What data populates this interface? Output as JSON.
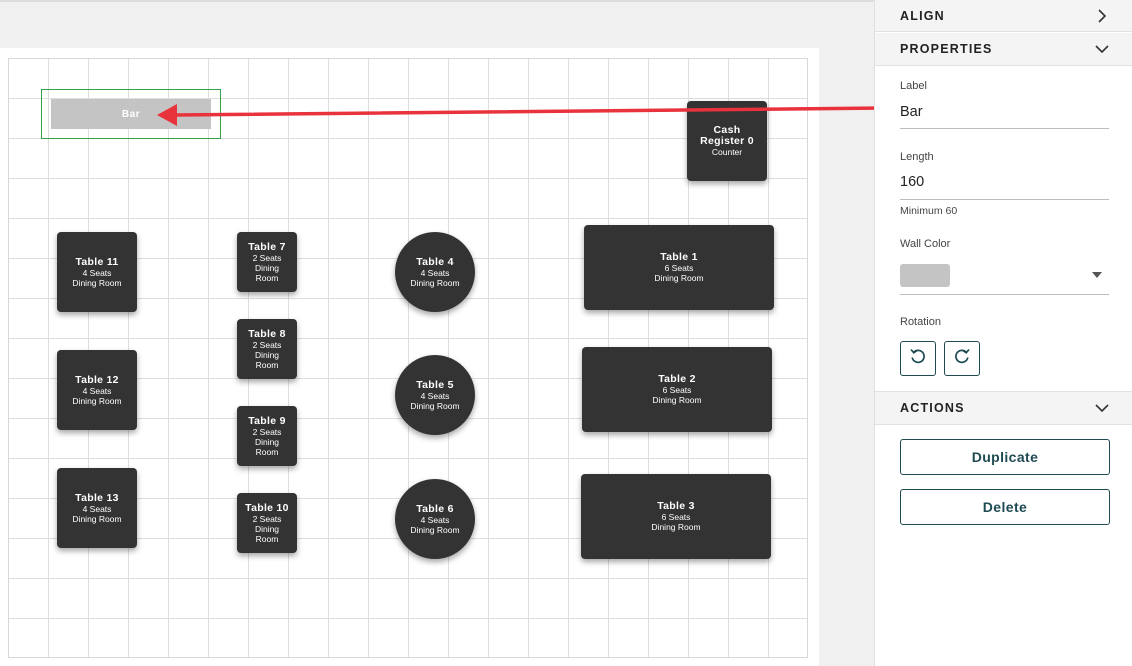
{
  "canvas": {
    "bar": {
      "label": "Bar"
    },
    "cash_register": {
      "name_line1": "Cash",
      "name_line2": "Register 0",
      "type": "Counter"
    },
    "tables": [
      {
        "name": "Table 11",
        "seats": "4 Seats",
        "room": "Dining Room"
      },
      {
        "name": "Table 12",
        "seats": "4 Seats",
        "room": "Dining Room"
      },
      {
        "name": "Table 13",
        "seats": "4 Seats",
        "room": "Dining Room"
      },
      {
        "name": "Table 7",
        "seats": "2 Seats",
        "room_line1": "Dining",
        "room_line2": "Room"
      },
      {
        "name": "Table 8",
        "seats": "2 Seats",
        "room_line1": "Dining",
        "room_line2": "Room"
      },
      {
        "name": "Table 9",
        "seats": "2 Seats",
        "room_line1": "Dining",
        "room_line2": "Room"
      },
      {
        "name": "Table 10",
        "seats": "2 Seats",
        "room_line1": "Dining",
        "room_line2": "Room"
      },
      {
        "name": "Table 4",
        "seats": "4 Seats",
        "room": "Dining Room"
      },
      {
        "name": "Table 5",
        "seats": "4 Seats",
        "room": "Dining Room"
      },
      {
        "name": "Table 6",
        "seats": "4 Seats",
        "room": "Dining Room"
      },
      {
        "name": "Table 1",
        "seats": "6 Seats",
        "room": "Dining Room"
      },
      {
        "name": "Table 2",
        "seats": "6 Seats",
        "room": "Dining Room"
      },
      {
        "name": "Table 3",
        "seats": "6 Seats",
        "room": "Dining Room"
      }
    ]
  },
  "panel": {
    "align": {
      "title": "ALIGN",
      "icon": "chevron-right-icon"
    },
    "properties": {
      "title": "PROPERTIES",
      "icon": "chevron-down-icon",
      "label_field": {
        "label": "Label",
        "value": "Bar"
      },
      "length_field": {
        "label": "Length",
        "value": "160",
        "hint": "Minimum 60"
      },
      "wall_color": {
        "label": "Wall Color",
        "value": "#c4c4c4"
      },
      "rotation": {
        "label": "Rotation",
        "left_icon": "rotate-left-icon",
        "right_icon": "rotate-right-icon"
      }
    },
    "actions": {
      "title": "ACTIONS",
      "icon": "chevron-down-icon",
      "duplicate": "Duplicate",
      "delete": "Delete"
    }
  },
  "colors": {
    "table": "#333333",
    "wall": "#c4c4c4",
    "selection": "#35a04a",
    "annotation_arrow": "#e8323c",
    "button_border": "#1e4a52"
  }
}
